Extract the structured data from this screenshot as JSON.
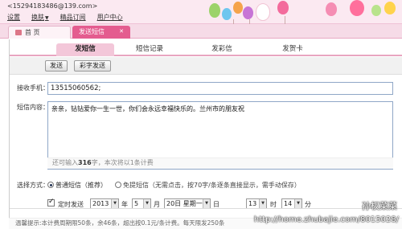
{
  "account": "<15294183486@139.com>",
  "topnav": [
    "设置",
    "换肤",
    "精品订阅",
    "用户中心"
  ],
  "page_tabs": {
    "home": "首 页",
    "active": "发送短信"
  },
  "subtabs": [
    "发短信",
    "短信记录",
    "发彩信",
    "发贺卡"
  ],
  "buttons": {
    "send": "发送",
    "color_send": "彩字发送"
  },
  "recipient": {
    "label": "接收手机：",
    "value": "13515060562;"
  },
  "message": {
    "label": "短信内容：",
    "text": "亲亲，钻钻爱你一生一世，你们会永远幸福快乐的。兰州市的朋友祝",
    "counter_prefix": "还可输入",
    "counter_remaining": "316",
    "counter_suffix": "字，本次将以1条计费"
  },
  "method": {
    "label": "选择方式：",
    "normal": "普通短信（推荐）",
    "free": "免提短信（无需点击，按70字/条逐条直接显示，需手动保存）"
  },
  "schedule": {
    "label": "定时发送",
    "year": "2013",
    "year_unit": "年",
    "month": "5",
    "month_unit": "月",
    "day": "20日 星期一",
    "day_unit": "日",
    "hour": "13",
    "hour_unit": "时",
    "minute": "14",
    "minute_unit": "分"
  },
  "tip": "温馨提示:本计费周期限50条，余46条，超出按0.1元/条计费。每天限发250条",
  "watermark": {
    "top": "孙权菜菜",
    "bottom": "http://home.zhubajie.com/8015028/"
  },
  "colors": {
    "accent": "#e45c8f",
    "tab_bg": "#f6dbe7"
  }
}
